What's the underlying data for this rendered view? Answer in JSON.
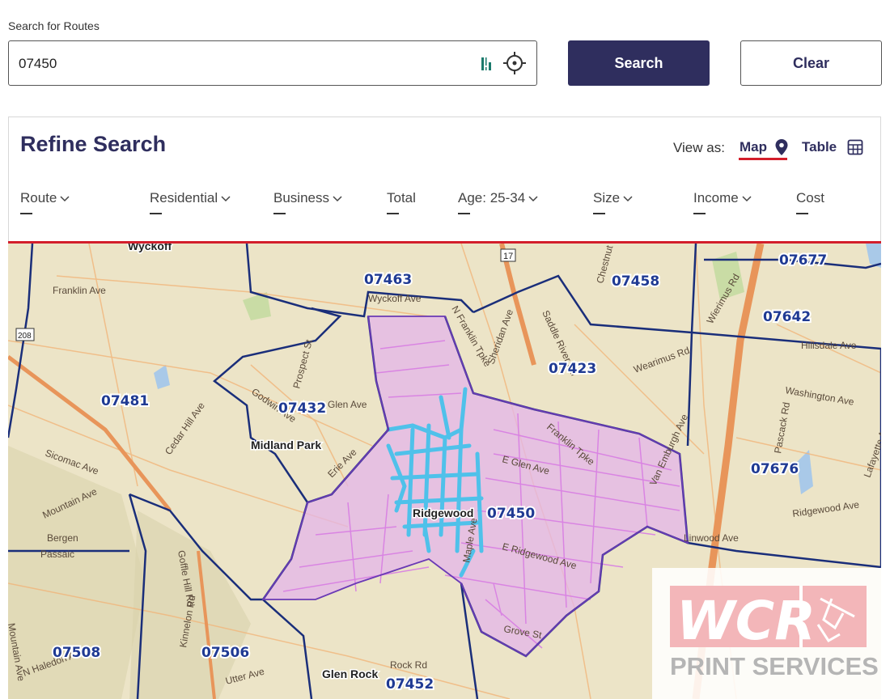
{
  "search": {
    "label": "Search for Routes",
    "value": "07450",
    "search_button": "Search",
    "clear_button": "Clear"
  },
  "refine": {
    "title": "Refine Search",
    "view_as_label": "View as:",
    "view_map": "Map",
    "view_table": "Table",
    "active_view": "Map"
  },
  "columns": [
    {
      "label": "Route",
      "value": "–",
      "sortable": true
    },
    {
      "label": "Residential",
      "value": "–",
      "sortable": true
    },
    {
      "label": "Business",
      "value": "–",
      "sortable": true
    },
    {
      "label": "Total",
      "value": "–",
      "sortable": false
    },
    {
      "label": "Age: 25-34",
      "value": "–",
      "sortable": true
    },
    {
      "label": "Size",
      "value": "–",
      "sortable": true
    },
    {
      "label": "Income",
      "value": "–",
      "sortable": true
    },
    {
      "label": "Cost",
      "value": "–",
      "sortable": false
    }
  ],
  "map": {
    "zip_labels": [
      "07463",
      "07458",
      "07677",
      "07642",
      "07423",
      "07481",
      "07432",
      "07450",
      "07676",
      "07508",
      "07506",
      "07452"
    ],
    "place_labels": [
      "Wyckoff",
      "Midland Park",
      "Ridgewood",
      "Glen Rock",
      "Bergen",
      "Passaic"
    ],
    "street_labels": [
      "Franklin Ave",
      "Wyckoff Ave",
      "Godwin Ave",
      "Glen Ave",
      "Cedar Hill Ave",
      "Sicomac Ave",
      "Mountain Ave",
      "Goffle Hill Rd",
      "Washington Ave",
      "Ridgewood Ave",
      "E Glen Ave",
      "Franklin Tpke",
      "Grove St",
      "Hillsdale Ave",
      "Prospect St",
      "Rock Rd",
      "Maple Ave",
      "N Franklin Tpke",
      "Sheridan Ave",
      "Van Emburgh Ave",
      "E Ridgewood Ave",
      "Erie Ave",
      "Linwood Ave",
      "Wearimus Rd",
      "Chestnut Ridge Rd",
      "N Haledon Ave",
      "Mountain Ave",
      "Utter Ave",
      "Kinnelon Rd",
      "Pascack Rd",
      "Lafayette Ave",
      "Wierimus Rd",
      "Saddle River Rd"
    ],
    "highway_shields": [
      "17",
      "208"
    ]
  },
  "logo": {
    "top_text": "WCR",
    "bottom_text": "PRINT SERVICES"
  },
  "colors": {
    "primary": "#2f2e5e",
    "accent_red": "#d31e2b",
    "map_base": "#ece4c7",
    "route_selected": "#4fc1ea",
    "route_area": "#d98ee8",
    "zip_border": "#1a2e7a",
    "logo_red": "#f3b6b9",
    "logo_gray": "#b5b5b5"
  },
  "icons": [
    "barcode-icon",
    "crosshair-target-icon",
    "map-pin-icon",
    "table-grid-icon",
    "chevron-down-icon"
  ]
}
